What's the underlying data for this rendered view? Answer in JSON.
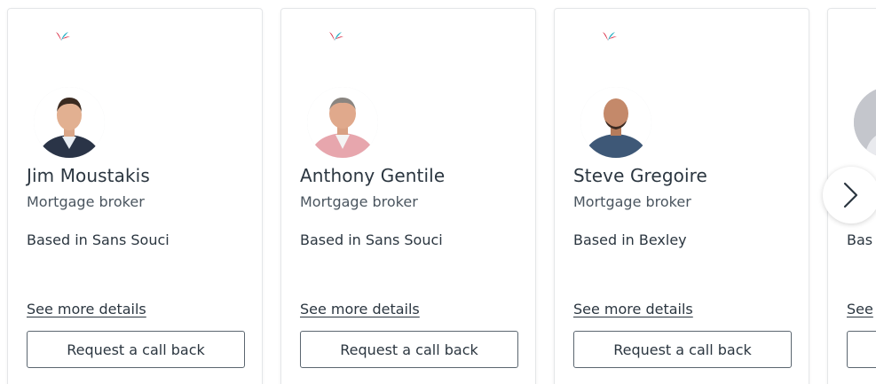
{
  "brokers": [
    {
      "name": "Jim Moustakis",
      "role": "Mortgage broker",
      "location": "Based in Sans Souci",
      "details_link": "See more details",
      "callback_label": "Request a call back"
    },
    {
      "name": "Anthony Gentile",
      "role": "Mortgage broker",
      "location": "Based in Sans Souci",
      "details_link": "See more details",
      "callback_label": "Request a call back"
    },
    {
      "name": "Steve Gregoire",
      "role": "Mortgage broker",
      "location": "Based in Bexley",
      "details_link": "See more details",
      "callback_label": "Request a call back"
    },
    {
      "name": "",
      "role": "",
      "location": "Bas",
      "details_link": "See",
      "callback_label": ""
    }
  ],
  "icons": {
    "brand": "brand-logo-icon",
    "next": "chevron-right-icon"
  },
  "colors": {
    "text": "#2b3640",
    "border": "#e4e6e8",
    "button_border": "#5b6670",
    "brand_red": "#d8203b",
    "brand_teal": "#2bb3c6"
  }
}
